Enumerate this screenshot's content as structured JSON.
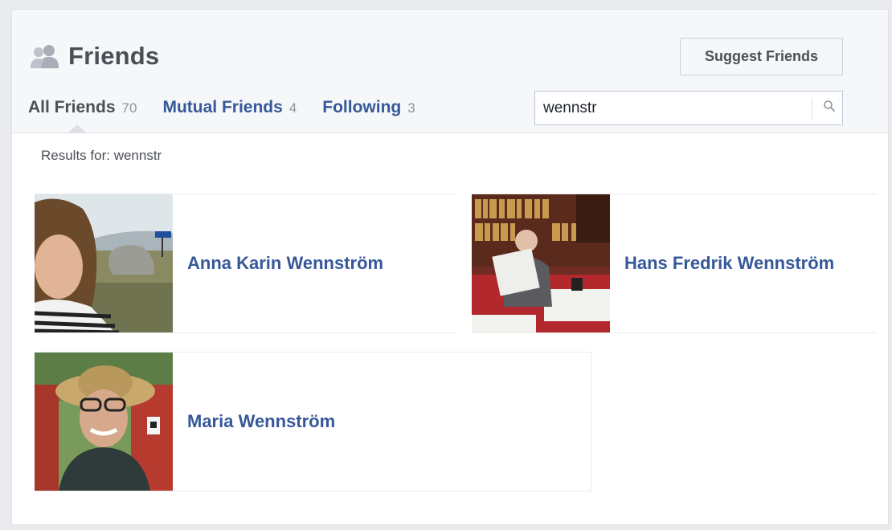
{
  "header": {
    "title": "Friends",
    "suggest_button": "Suggest Friends"
  },
  "tabs": [
    {
      "label": "All Friends",
      "count": "70",
      "active": true
    },
    {
      "label": "Mutual Friends",
      "count": "4",
      "active": false
    },
    {
      "label": "Following",
      "count": "3",
      "active": false
    }
  ],
  "search": {
    "value": "wennstr",
    "icon": "search-icon"
  },
  "results_for": "Results for: wennstr",
  "friends": [
    {
      "name": "Anna Karin Wennström",
      "avatar": "woman-striped-shirt-outdoors"
    },
    {
      "name": "Hans Fredrik Wennström",
      "avatar": "man-reading-newspaper-library"
    },
    {
      "name": "Maria Wennström",
      "avatar": "woman-sun-hat-glasses"
    }
  ],
  "colors": {
    "link": "#365899",
    "header_bg": "#f6f7f9",
    "page_bg": "#e9ebee"
  }
}
